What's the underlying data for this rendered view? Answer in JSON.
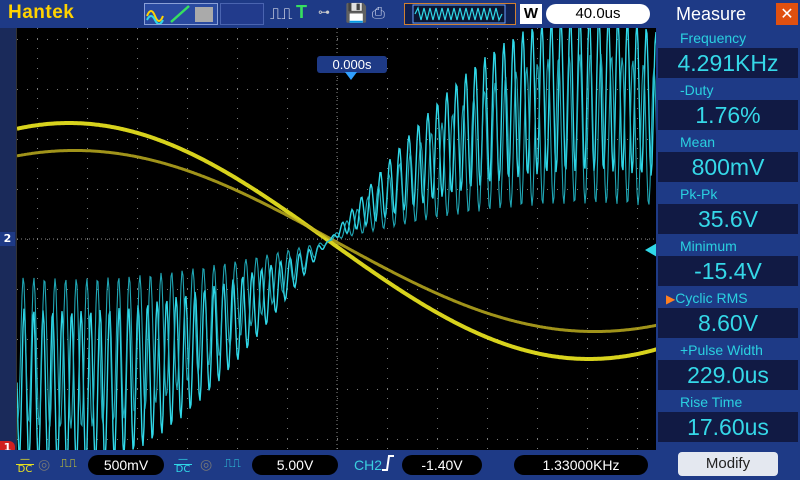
{
  "header": {
    "brand": "Hantek",
    "trigger_position": "0.000s",
    "w_badge": "W",
    "timebase": "40.0us"
  },
  "channels": {
    "ch1": {
      "marker": "1",
      "coupling": "DC",
      "scale": "500mV",
      "color": "#e8e020"
    },
    "ch2": {
      "marker": "2",
      "coupling": "DC",
      "scale": "5.00V",
      "color": "#30d8e8"
    }
  },
  "trigger": {
    "source": "CH2",
    "edge": "rising-edge-icon",
    "level": "-1.40V",
    "frequency": "1.33000KHz"
  },
  "measure": {
    "title": "Measure",
    "items": [
      {
        "label": "Frequency",
        "value": "4.291KHz"
      },
      {
        "label": "-Duty",
        "value": "1.76%"
      },
      {
        "label": "Mean",
        "value": "800mV"
      },
      {
        "label": "Pk-Pk",
        "value": "35.6V"
      },
      {
        "label": "Minimum",
        "value": "-15.4V"
      },
      {
        "label": "Cyclic RMS",
        "value": "8.60V",
        "selected": true
      },
      {
        "label": "+Pulse Width",
        "value": "229.0us"
      },
      {
        "label": "Rise Time",
        "value": "17.60us"
      }
    ],
    "modify_label": "Modify"
  },
  "colors": {
    "bar": "#1e3a86",
    "ch1": "#e8e020",
    "ch2": "#30d8e8",
    "grid": "#6a6a6a"
  }
}
